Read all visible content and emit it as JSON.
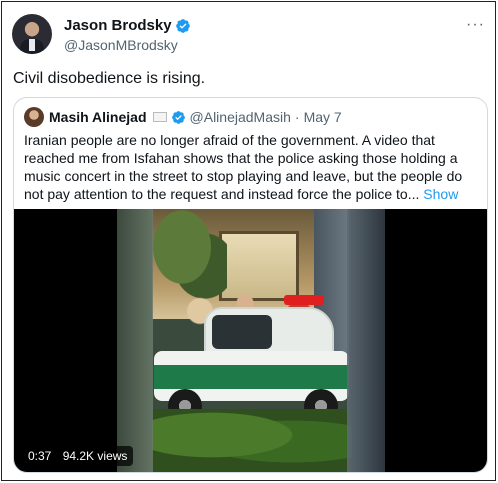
{
  "tweet": {
    "author": {
      "name": "Jason Brodsky",
      "handle": "@JasonMBrodsky",
      "verified": true
    },
    "text": "Civil disobedience is rising.",
    "more_icon": "more-horizontal-icon"
  },
  "quote": {
    "author": {
      "name": "Masih Alinejad",
      "handle": "@AlinejadMasih",
      "verified": true
    },
    "separator": "·",
    "date": "May 7",
    "body": "Iranian people are no longer afraid of the government. A video that reached me from Isfahan shows that the police asking those holding a music concert in the street to stop playing and leave, but the people do not pay attention to the request and instead force the police to...",
    "show_more": "Show more",
    "video": {
      "duration": "0:37",
      "views": "94.2K views"
    }
  },
  "colors": {
    "accent": "#1d9bf0",
    "text": "#0f1419",
    "muted": "#536471",
    "border": "#cfd9de"
  }
}
